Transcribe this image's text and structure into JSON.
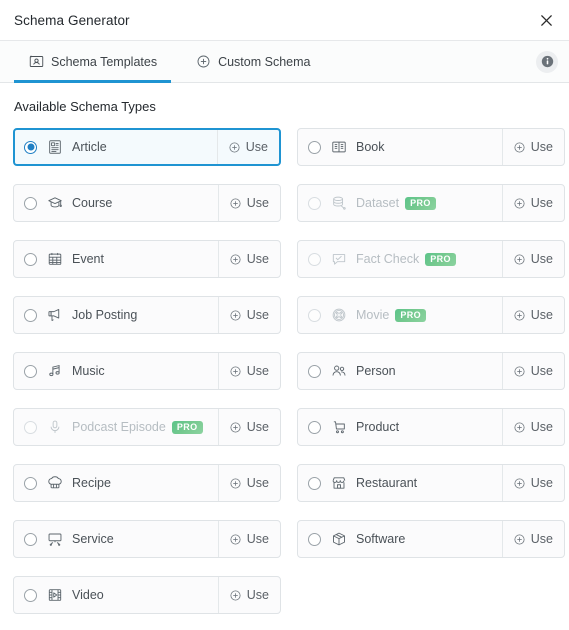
{
  "window": {
    "title": "Schema Generator",
    "close_icon": "close-icon"
  },
  "tabs": [
    {
      "label": "Schema Templates",
      "icon": "schema-template-icon",
      "active": true
    },
    {
      "label": "Custom Schema",
      "icon": "plus-circle-icon",
      "active": false
    }
  ],
  "info_button": {
    "icon": "info-icon"
  },
  "section": {
    "title": "Available Schema Types"
  },
  "labels": {
    "use": "Use",
    "pro": "PRO"
  },
  "colors": {
    "accent": "#1f94d2",
    "selected_bg": "#f4fafd",
    "pro_badge": "#6ec98d",
    "row_border": "#dfe3e6",
    "text": "#4a5157",
    "disabled_text": "#b6bdc2"
  },
  "schema_types": [
    {
      "name": "Article",
      "icon": "article-icon",
      "selected": true,
      "pro": false,
      "column": "left"
    },
    {
      "name": "Book",
      "icon": "book-icon",
      "selected": false,
      "pro": false,
      "column": "right"
    },
    {
      "name": "Course",
      "icon": "graduation-cap-icon",
      "selected": false,
      "pro": false,
      "column": "left"
    },
    {
      "name": "Dataset",
      "icon": "database-icon",
      "selected": false,
      "pro": true,
      "column": "right"
    },
    {
      "name": "Event",
      "icon": "calendar-icon",
      "selected": false,
      "pro": false,
      "column": "left"
    },
    {
      "name": "Fact Check",
      "icon": "check-bubble-icon",
      "selected": false,
      "pro": true,
      "column": "right"
    },
    {
      "name": "Job Posting",
      "icon": "megaphone-icon",
      "selected": false,
      "pro": false,
      "column": "left"
    },
    {
      "name": "Movie",
      "icon": "film-reel-icon",
      "selected": false,
      "pro": true,
      "column": "right"
    },
    {
      "name": "Music",
      "icon": "music-note-icon",
      "selected": false,
      "pro": false,
      "column": "left"
    },
    {
      "name": "Person",
      "icon": "people-icon",
      "selected": false,
      "pro": false,
      "column": "right"
    },
    {
      "name": "Podcast Episode",
      "icon": "microphone-icon",
      "selected": false,
      "pro": true,
      "column": "left"
    },
    {
      "name": "Product",
      "icon": "shopping-cart-icon",
      "selected": false,
      "pro": false,
      "column": "right"
    },
    {
      "name": "Recipe",
      "icon": "chef-hat-icon",
      "selected": false,
      "pro": false,
      "column": "left"
    },
    {
      "name": "Restaurant",
      "icon": "storefront-icon",
      "selected": false,
      "pro": false,
      "column": "right"
    },
    {
      "name": "Service",
      "icon": "service-desk-icon",
      "selected": false,
      "pro": false,
      "column": "left"
    },
    {
      "name": "Software",
      "icon": "package-box-icon",
      "selected": false,
      "pro": false,
      "column": "right"
    },
    {
      "name": "Video",
      "icon": "video-film-icon",
      "selected": false,
      "pro": false,
      "column": "left"
    }
  ]
}
